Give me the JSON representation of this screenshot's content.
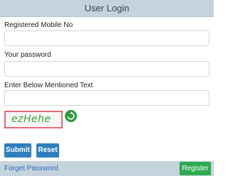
{
  "header": {
    "title": "User Login"
  },
  "form": {
    "mobile_label": "Registered Mobile No",
    "mobile_value": "",
    "password_label": "Your password",
    "password_value": "",
    "captcha_input_label": "Enter Below Mentioned Text",
    "captcha_input_value": "",
    "captcha_text": "ezHehe",
    "refresh_icon": "refresh-icon",
    "submit_label": "Submit",
    "reset_label": "Reset"
  },
  "footer": {
    "forgot_label": "Forget Password",
    "register_label": "Register"
  },
  "colors": {
    "header_bg": "#c5d3dd",
    "primary_button": "#2f7fbf",
    "register_button": "#2eab4e",
    "captcha_border": "#e8667a",
    "captcha_text": "#3ea43a",
    "link": "#2a6fb8"
  }
}
